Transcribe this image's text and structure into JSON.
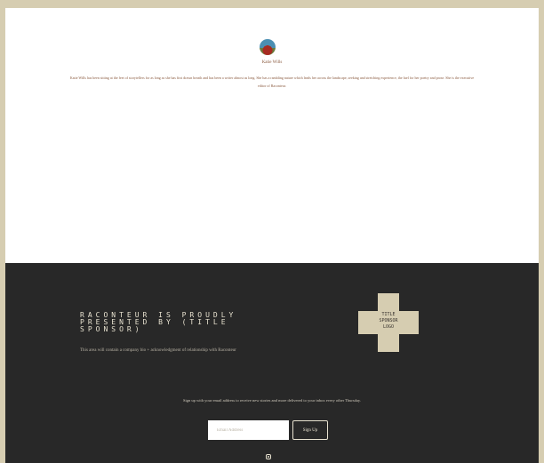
{
  "author": {
    "name": "Katie Wills",
    "bio": "Katie Wills has been sitting at the feet of storytellers for as long as she has first drawn breath and has been a writer almost as long. She has a rambling nature which leads her across the landscape, seeking and stretching experience, the fuel for her poetry and prose. She is the executive editor of Raconteur."
  },
  "footer": {
    "sponsor_heading": "RACONTEUR IS PROUDLY PRESENTED BY (TITLE SPONSOR)",
    "sponsor_description": "This area will contain a company bio + acknowledgment of relationship with Raconteur",
    "logo_text": "TITLE\nSPONSOR\nLOGO",
    "signup_text": "Sign up with your email address to receive new stories and more delivered to your inbox every other Thursday.",
    "email_placeholder": "Email Address",
    "signup_button": "Sign Up",
    "social_icon": "instagram-icon"
  },
  "colors": {
    "page_background": "#d6cdb1",
    "footer_background": "#282828",
    "accent_text": "#8a5a3f",
    "logo_background": "#d6cdb1"
  }
}
